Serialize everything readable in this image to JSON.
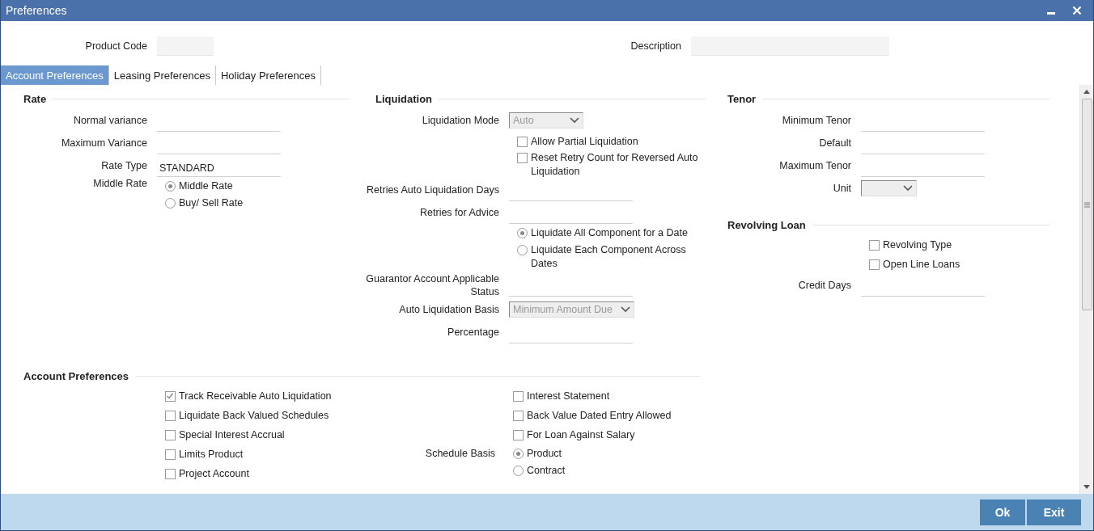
{
  "window": {
    "title": "Preferences"
  },
  "header": {
    "fields": [
      {
        "label": "Product Code"
      },
      {
        "label": "Description"
      }
    ]
  },
  "tabs": [
    {
      "label": "Account Preferences",
      "selected": true
    },
    {
      "label": "Leasing Preferences",
      "selected": false
    },
    {
      "label": "Holiday Preferences",
      "selected": false
    }
  ],
  "columns": [
    {
      "sections": [
        {
          "title": "Rate",
          "fields": [
            {
              "kind": "text",
              "label": "Normal variance"
            },
            {
              "kind": "text",
              "label": "Maximum Variance"
            },
            {
              "kind": "text",
              "label": "Rate Type",
              "value": "STANDARD"
            },
            {
              "kind": "radio",
              "label": "Middle Rate",
              "options": [
                {
                  "label": "Middle Rate",
                  "selected": true
                },
                {
                  "label": "Buy/ Sell Rate",
                  "selected": false
                }
              ]
            }
          ]
        }
      ]
    },
    {
      "sections": [
        {
          "title": "Liquidation",
          "fields": [
            {
              "kind": "select",
              "label": "Liquidation Mode",
              "value": "Auto",
              "disabled": true
            },
            {
              "kind": "checkbox",
              "text": "Allow Partial Liquidation",
              "checked": false
            },
            {
              "kind": "checkbox",
              "text": "Reset Retry Count for Reversed Auto Liquidation",
              "checked": false
            },
            {
              "kind": "text",
              "label": "Retries Auto Liquidation Days"
            },
            {
              "kind": "text",
              "label": "Retries for Advice"
            },
            {
              "kind": "radio",
              "options": [
                {
                  "label": "Liquidate All Component for a Date",
                  "selected": true
                },
                {
                  "label": "Liquidate Each Component Across Dates",
                  "selected": false
                }
              ]
            },
            {
              "kind": "text",
              "label": "Guarantor Account Applicable Status"
            },
            {
              "kind": "select",
              "label": "Auto Liquidation Basis",
              "value": "Minimum Amount Due",
              "disabled": true
            },
            {
              "kind": "text",
              "label": "Percentage"
            }
          ]
        }
      ]
    },
    {
      "sections": [
        {
          "title": "Tenor",
          "fields": [
            {
              "kind": "text",
              "label": "Minimum Tenor"
            },
            {
              "kind": "text",
              "label": "Default"
            },
            {
              "kind": "text",
              "label": "Maximum Tenor"
            },
            {
              "kind": "select",
              "label": "Unit"
            }
          ]
        },
        {
          "title": "Revolving Loan",
          "fields": [
            {
              "kind": "checkbox",
              "text": "Revolving Type",
              "checked": false
            },
            {
              "kind": "checkbox",
              "text": "Open Line Loans",
              "checked": false
            },
            {
              "kind": "text",
              "label": "Credit Days"
            }
          ]
        }
      ]
    }
  ],
  "account_preferences": {
    "title": "Account Preferences",
    "columns": [
      {
        "fields": [
          {
            "kind": "checkbox",
            "text": "Track Receivable Auto Liquidation",
            "checked": true
          },
          {
            "kind": "checkbox",
            "text": "Liquidate Back Valued Schedules",
            "checked": false
          },
          {
            "kind": "checkbox",
            "text": "Special Interest Accrual",
            "checked": false
          },
          {
            "kind": "checkbox",
            "text": "Limits Product",
            "checked": false
          },
          {
            "kind": "checkbox",
            "text": "Project Account",
            "checked": false
          }
        ]
      },
      {
        "fields": [
          {
            "kind": "checkbox",
            "text": "Interest Statement",
            "checked": false
          },
          {
            "kind": "checkbox",
            "text": "Back Value Dated Entry Allowed",
            "checked": false
          },
          {
            "kind": "checkbox",
            "text": "For Loan Against Salary",
            "checked": false
          },
          {
            "kind": "radio",
            "label": "Schedule Basis",
            "options": [
              {
                "label": "Product",
                "selected": true
              },
              {
                "label": "Contract",
                "selected": false
              }
            ]
          }
        ]
      }
    ]
  },
  "buttons": [
    "Ok",
    "Exit"
  ]
}
